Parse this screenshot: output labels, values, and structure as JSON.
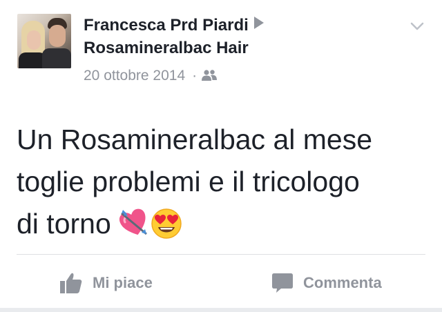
{
  "post": {
    "author_name": "Francesca Prd Piardi",
    "target_page": "Rosamineralbac Hair",
    "date": "20 ottobre 2014",
    "separator": "·",
    "privacy_icon": "friends-icon",
    "text_line1": "Un Rosamineralbac al mese",
    "text_line2": "toglie problemi e il tricologo",
    "text_line3": "di torno",
    "emojis": [
      "heart-with-arrow",
      "heart-eyes-face"
    ]
  },
  "actions": {
    "like_label": "Mi piace",
    "comment_label": "Commenta"
  },
  "colors": {
    "text_primary": "#1d2129",
    "text_secondary": "#90949c",
    "divider": "#dddfe2"
  }
}
